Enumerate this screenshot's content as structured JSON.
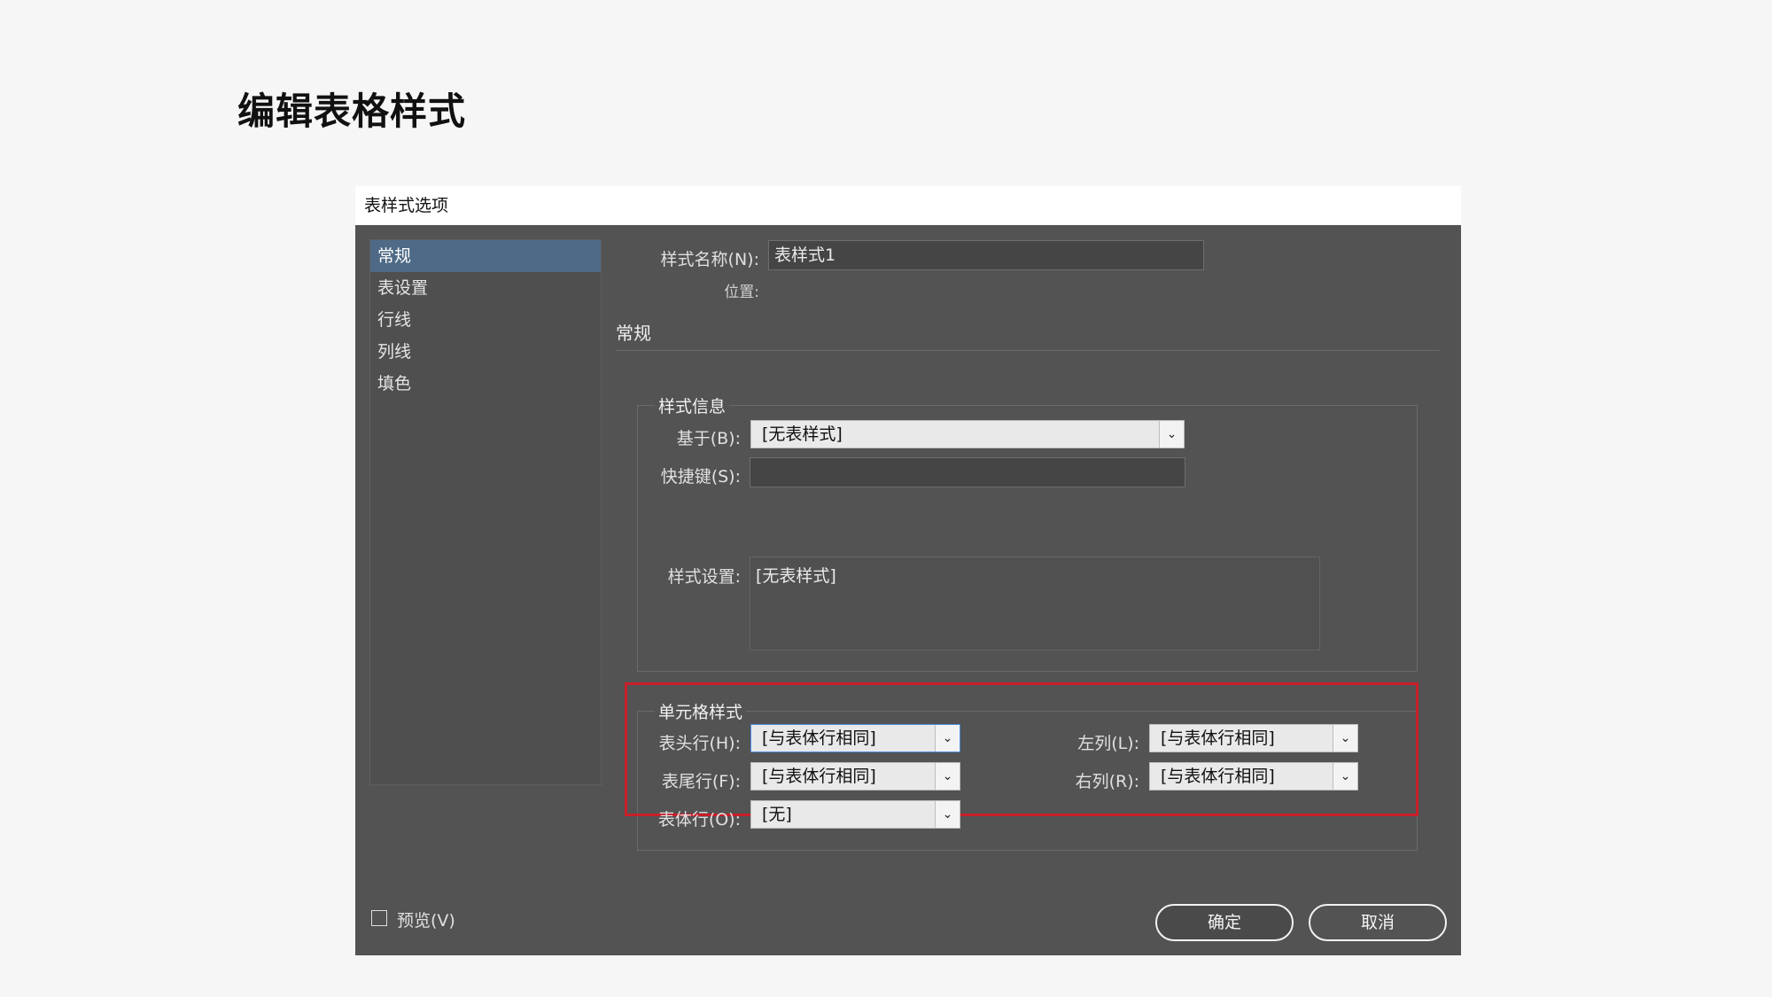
{
  "slide": {
    "title": "编辑表格样式"
  },
  "dialog": {
    "title": "表样式选项",
    "sidebar": {
      "items": [
        {
          "label": "常规",
          "active": true
        },
        {
          "label": "表设置",
          "active": false
        },
        {
          "label": "行线",
          "active": false
        },
        {
          "label": "列线",
          "active": false
        },
        {
          "label": "填色",
          "active": false
        }
      ]
    },
    "style_name": {
      "label": "样式名称(N):",
      "value": "表样式1"
    },
    "location": {
      "label": "位置:"
    },
    "section": "常规",
    "style_info": {
      "title": "样式信息",
      "based_on": {
        "label": "基于(B):",
        "value": "[无表样式]"
      },
      "shortcut": {
        "label": "快捷键(S):",
        "value": ""
      },
      "settings": {
        "label": "样式设置:",
        "value": "[无表样式]"
      }
    },
    "cell_styles": {
      "title": "单元格样式",
      "header_row": {
        "label": "表头行(H):",
        "value": "[与表体行相同]"
      },
      "footer_row": {
        "label": "表尾行(F):",
        "value": "[与表体行相同]"
      },
      "body_row": {
        "label": "表体行(O):",
        "value": "[无]"
      },
      "left_col": {
        "label": "左列(L):",
        "value": "[与表体行相同]"
      },
      "right_col": {
        "label": "右列(R):",
        "value": "[与表体行相同]"
      },
      "highlight_color": "#c81e28"
    },
    "preview": {
      "label": "预览(V)",
      "checked": false
    },
    "buttons": {
      "ok": "确定",
      "cancel": "取消"
    }
  }
}
